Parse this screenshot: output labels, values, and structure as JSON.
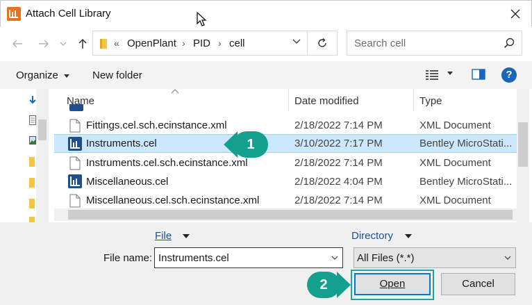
{
  "window": {
    "title": "Attach Cell Library"
  },
  "nav": {
    "breadcrumb": [
      "OpenPlant",
      "PID",
      "cell"
    ],
    "overflow": "«",
    "search_placeholder": "Search cell"
  },
  "toolbar": {
    "organize_label": "Organize",
    "new_folder_label": "New folder",
    "help_label": "?"
  },
  "columns": {
    "name": "Name",
    "date": "Date modified",
    "type": "Type"
  },
  "files": [
    {
      "name": "Fittings.cel.sch.ecinstance.xml",
      "date": "2/18/2022 7:14 PM",
      "type": "XML Document",
      "icon": "xml-file-icon"
    },
    {
      "name": "Instruments.cel",
      "date": "3/10/2022 7:17 PM",
      "type": "Bentley MicroStati...",
      "icon": "cell-library-icon",
      "selected": true
    },
    {
      "name": "Instruments.cel.sch.ecinstance.xml",
      "date": "2/18/2022 7:14 PM",
      "type": "XML Document",
      "icon": "xml-file-icon"
    },
    {
      "name": "Miscellaneous.cel",
      "date": "2/18/2022 4:04 PM",
      "type": "Bentley MicroStati...",
      "icon": "cell-library-icon"
    },
    {
      "name": "Miscellaneous.cel.sch.ecinstance.xml",
      "date": "2/18/2022 7:14 PM",
      "type": "XML Document",
      "icon": "xml-file-icon"
    }
  ],
  "bottom": {
    "file_menu": "File",
    "directory_menu": "Directory",
    "file_name_label": "File name:",
    "file_name_value": "Instruments.cel",
    "filter_value": "All Files (*.*)",
    "open_label": "Open",
    "cancel_label": "Cancel"
  },
  "callouts": {
    "one": "1",
    "two": "2"
  },
  "colors": {
    "accent": "#14a08f",
    "selection": "#cce8ff",
    "app_icon": "#e8731a",
    "cell_icon": "#1f4e8c"
  }
}
